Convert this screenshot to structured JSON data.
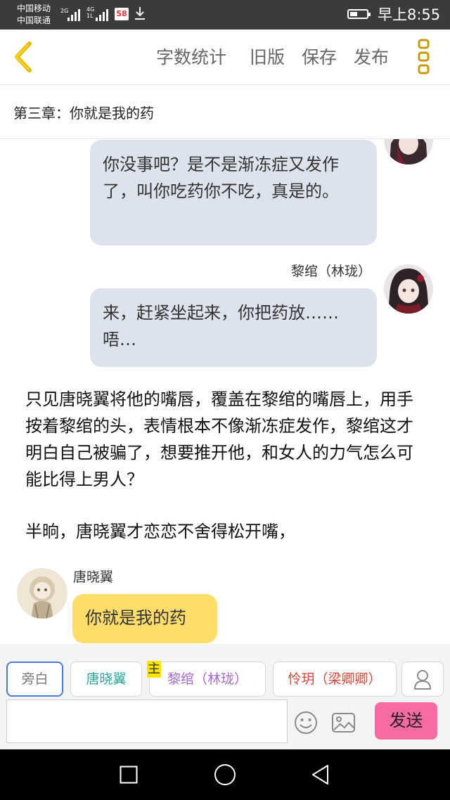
{
  "status_bar": {
    "carrier_1": "中国移动",
    "carrier_2": "中国联通",
    "net_1": "2G",
    "net_2a": "4G",
    "net_2b": "1L",
    "app_badge": "58",
    "time": "早上8:55"
  },
  "header": {
    "word_count": "字数统计",
    "old_version": "旧版",
    "save": "保存",
    "publish": "发布"
  },
  "chapter_title": "第三章：你就是我的药",
  "messages": {
    "m1_text": "你没事吧？是不是渐冻症又发作了，叫你吃药你不吃，真是的。",
    "m2_speaker": "黎绾（林珑）",
    "m2_text": "来，赶紧坐起来，你把药放……唔…",
    "narration_1": "只见唐晓翼将他的嘴唇，覆盖在黎绾的嘴唇上，用手按着黎绾的头，表情根本不像渐冻症发作，黎绾这才明白自己被骗了，想要推开他，和女人的力气怎么可能比得上男人？",
    "narration_2": "半晌，唐晓翼才恋恋不舍得松开嘴，",
    "m3_speaker": "唐晓翼",
    "m3_text": "你就是我的药"
  },
  "roles": {
    "narrator": "旁白",
    "role_1": "唐晓翼",
    "main_tag": "主",
    "role_2": "黎绾（林珑）",
    "role_3": "怜玥（梁卿卿）"
  },
  "input": {
    "placeholder": "",
    "send": "发送"
  },
  "colors": {
    "accent_yellow": "#f6c400",
    "bubble_gray": "#dde3ed",
    "bubble_yellow": "#fedd6a",
    "send_pink": "#f76ba3",
    "role_teal": "#2aa6a0",
    "role_purple": "#a46ad0",
    "role_red": "#d9473b",
    "narrator_blue": "#4a7bd6"
  }
}
